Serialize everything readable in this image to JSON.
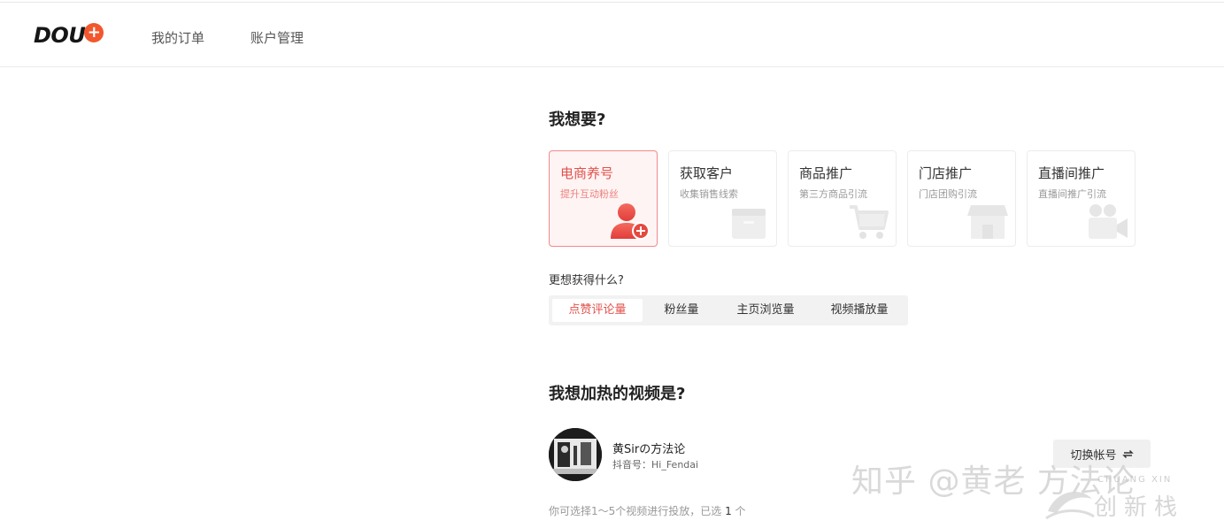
{
  "header": {
    "logo_text": "DOU",
    "logo_plus": "+",
    "nav": [
      {
        "label": "我的订单"
      },
      {
        "label": "账户管理"
      }
    ]
  },
  "goal": {
    "title": "我想要?",
    "cards": [
      {
        "title": "电商养号",
        "subtitle": "提升互动粉丝",
        "icon": "user-plus-icon",
        "active": true
      },
      {
        "title": "获取客户",
        "subtitle": "收集销售线索",
        "icon": "box-icon",
        "active": false
      },
      {
        "title": "商品推广",
        "subtitle": "第三方商品引流",
        "icon": "shopping-cart-icon",
        "active": false
      },
      {
        "title": "门店推广",
        "subtitle": "门店团购引流",
        "icon": "storefront-icon",
        "active": false
      },
      {
        "title": "直播间推广",
        "subtitle": "直播间推广引流",
        "icon": "video-camera-icon",
        "active": false
      }
    ]
  },
  "metric": {
    "question": "更想获得什么?",
    "tabs": [
      {
        "label": "点赞评论量",
        "active": true
      },
      {
        "label": "粉丝量",
        "active": false
      },
      {
        "label": "主页浏览量",
        "active": false
      },
      {
        "label": "视频播放量",
        "active": false
      }
    ]
  },
  "video": {
    "title": "我想加热的视频是?",
    "account_name": "黄Sirの方法论",
    "account_id": "抖音号：Hi_Fendai",
    "switch_label": "切换帐号",
    "hint_prefix": "你可选择1～5个视频进行投放，已选 ",
    "hint_count": "1",
    "hint_suffix": " 个"
  },
  "watermark": {
    "text": "知乎 @黄老 方法论",
    "logo_text": "创新栈",
    "logo_small": "CHUANG XIN"
  },
  "colors": {
    "accent": "#e0524c",
    "active_card_bg": "#fff4f4",
    "active_card_border": "#f08a8a",
    "logo_orange": "#f2572d"
  }
}
